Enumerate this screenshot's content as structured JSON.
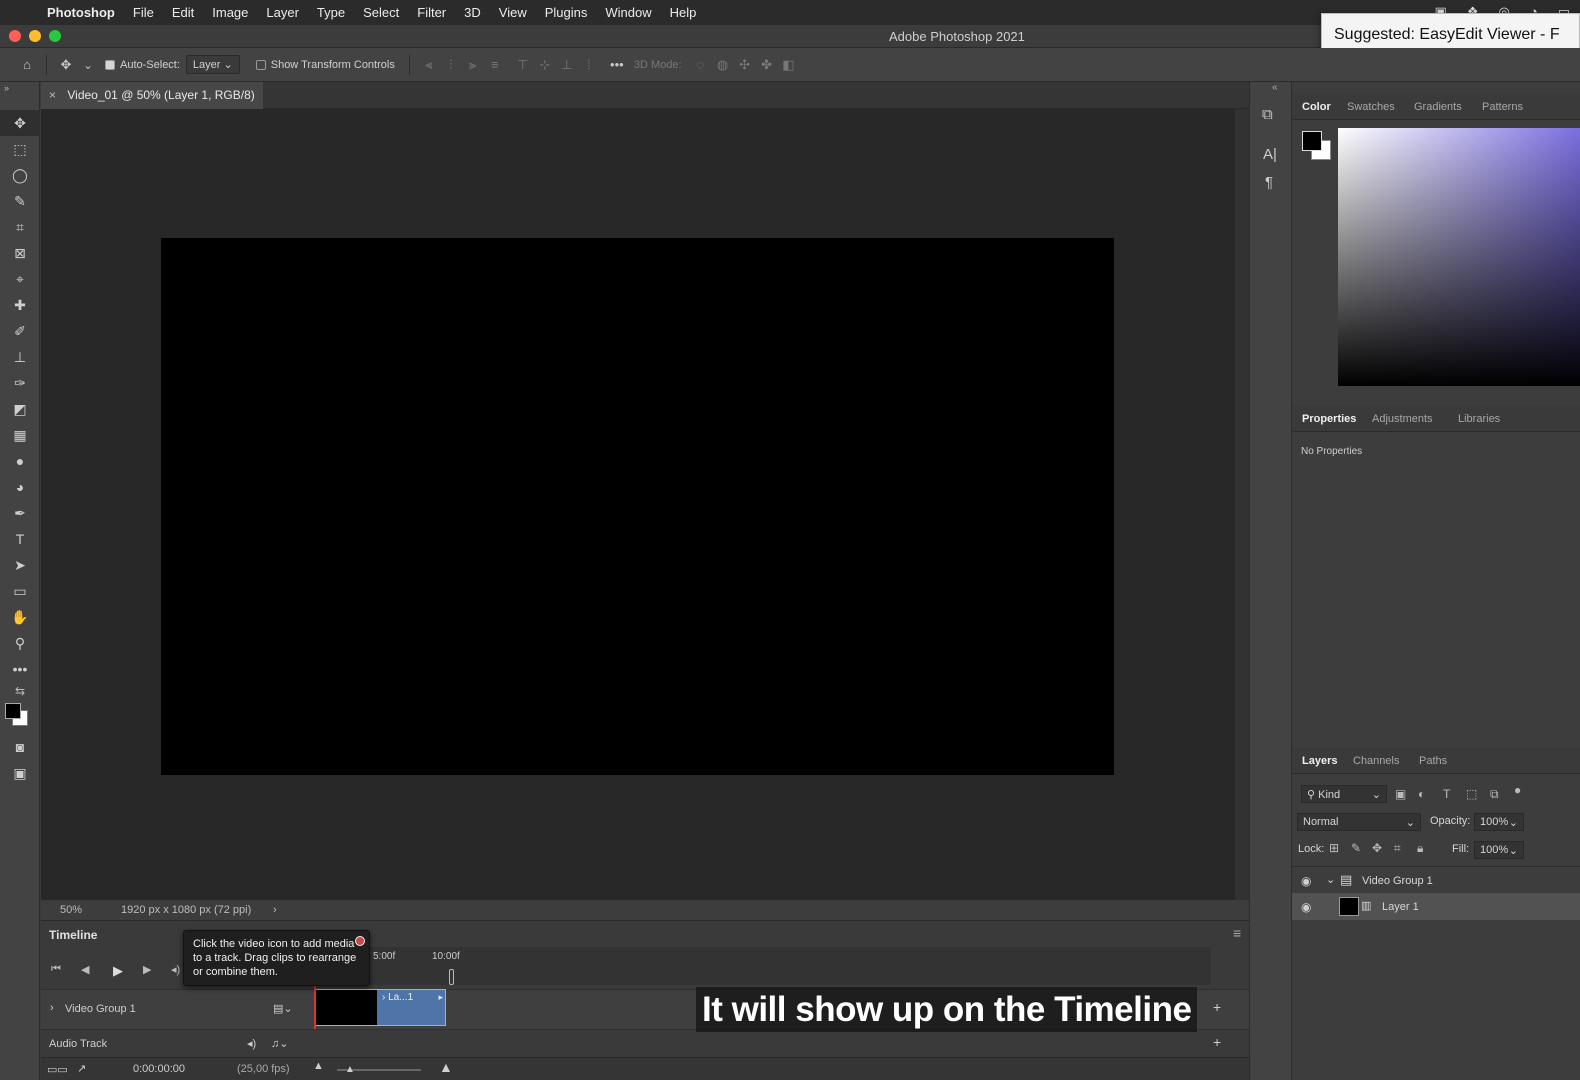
{
  "menubar": {
    "items": [
      "Photoshop",
      "File",
      "Edit",
      "Image",
      "Layer",
      "Type",
      "Select",
      "Filter",
      "3D",
      "View",
      "Plugins",
      "Window",
      "Help"
    ]
  },
  "window": {
    "title": "Adobe Photoshop 2021"
  },
  "suggestion": {
    "text": "Suggested: EasyEdit Viewer - F"
  },
  "options": {
    "auto_select_label": "Auto-Select:",
    "auto_select_value": "Layer",
    "transform_label": "Show Transform Controls",
    "mode_3d_label": "3D Mode:"
  },
  "document": {
    "tab_title": "Video_01 @ 50% (Layer 1, RGB/8)",
    "zoom": "50%",
    "info": "1920 px x 1080 px (72 ppi)"
  },
  "timeline": {
    "title": "Timeline",
    "tooltip": "Click the video icon to add media to a track. Drag clips to rearrange or combine them.",
    "ruler_labels": [
      "5:00f",
      "10:00f"
    ],
    "video_group": "Video Group 1",
    "clip_label": "La...1",
    "audio_track": "Audio Track",
    "timecode": "0:00:00:00",
    "fps": "(25,00 fps)"
  },
  "caption": {
    "text": "It will show up on the Timeline"
  },
  "color_panel": {
    "tabs": [
      "Color",
      "Swatches",
      "Gradients",
      "Patterns"
    ]
  },
  "properties_panel": {
    "tabs": [
      "Properties",
      "Adjustments",
      "Libraries"
    ],
    "empty_text": "No Properties"
  },
  "layers_panel": {
    "tabs": [
      "Layers",
      "Channels",
      "Paths"
    ],
    "filter_label": "Kind",
    "blend_mode": "Normal",
    "opacity_label": "Opacity:",
    "opacity_value": "100%",
    "lock_label": "Lock:",
    "fill_label": "Fill:",
    "fill_value": "100%",
    "layers": [
      "Video Group 1",
      "Layer 1"
    ]
  },
  "colors": {
    "accent": "#4f74a8",
    "canvas": "#000000",
    "workspace": "#282828"
  }
}
